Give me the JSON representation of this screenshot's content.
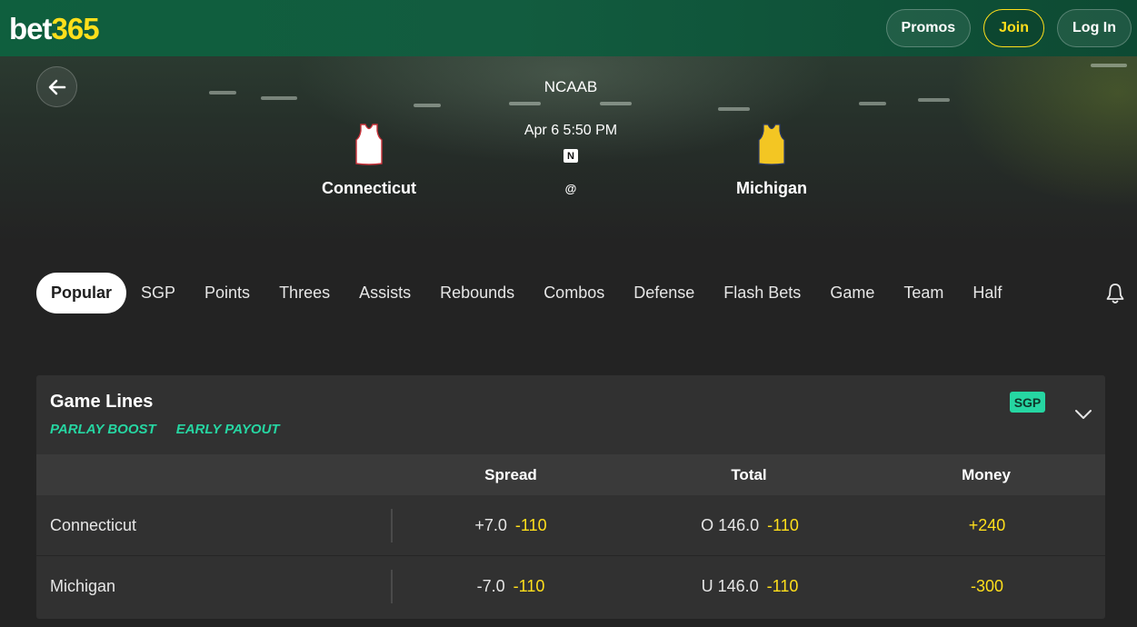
{
  "header": {
    "logo_part1": "bet",
    "logo_part2": "365",
    "promos_label": "Promos",
    "join_label": "Join",
    "login_label": "Log In",
    "brand_yellow": "#ffdf1b",
    "brand_green": "#125c3f"
  },
  "event": {
    "league": "NCAAB",
    "datetime": "Apr 6 5:50 PM",
    "network_badge": "N",
    "separator": "@",
    "home_team": "Connecticut",
    "away_team": "Michigan"
  },
  "tabs": [
    {
      "label": "Popular",
      "active": true
    },
    {
      "label": "SGP"
    },
    {
      "label": "Points"
    },
    {
      "label": "Threes"
    },
    {
      "label": "Assists"
    },
    {
      "label": "Rebounds"
    },
    {
      "label": "Combos"
    },
    {
      "label": "Defense"
    },
    {
      "label": "Flash Bets"
    },
    {
      "label": "Game"
    },
    {
      "label": "Team"
    },
    {
      "label": "Half"
    }
  ],
  "market": {
    "title": "Game Lines",
    "badge_parlay": "PARLAY BOOST",
    "badge_payout": "EARLY PAYOUT",
    "sgp_tag": "SGP",
    "accent": "#26d6a2",
    "columns": [
      "Spread",
      "Total",
      "Money"
    ],
    "rows": [
      {
        "team": "Connecticut",
        "spread_hcp": "+7.0",
        "spread_price": "-110",
        "total_hcp": "O 146.0",
        "total_price": "-110",
        "money": "+240"
      },
      {
        "team": "Michigan",
        "spread_hcp": "-7.0",
        "spread_price": "-110",
        "total_hcp": "U 146.0",
        "total_price": "-110",
        "money": "-300"
      }
    ]
  }
}
